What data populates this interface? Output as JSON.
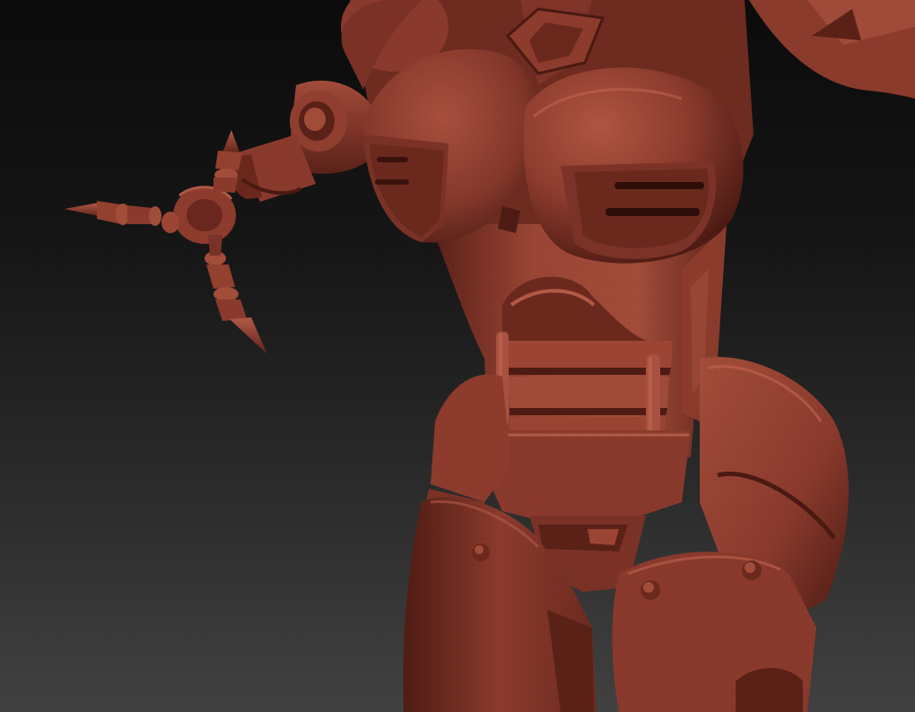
{
  "scene": {
    "subject": "robot-torso-sculpt",
    "colors": {
      "background_top": "#0b0b0b",
      "background_bottom": "#414141",
      "clay_base": "#7a3226",
      "clay_light": "#a24a3a",
      "clay_highlight": "#c0604a",
      "clay_dark": "#4a1a12",
      "clay_shadow": "#2e0e09"
    }
  }
}
